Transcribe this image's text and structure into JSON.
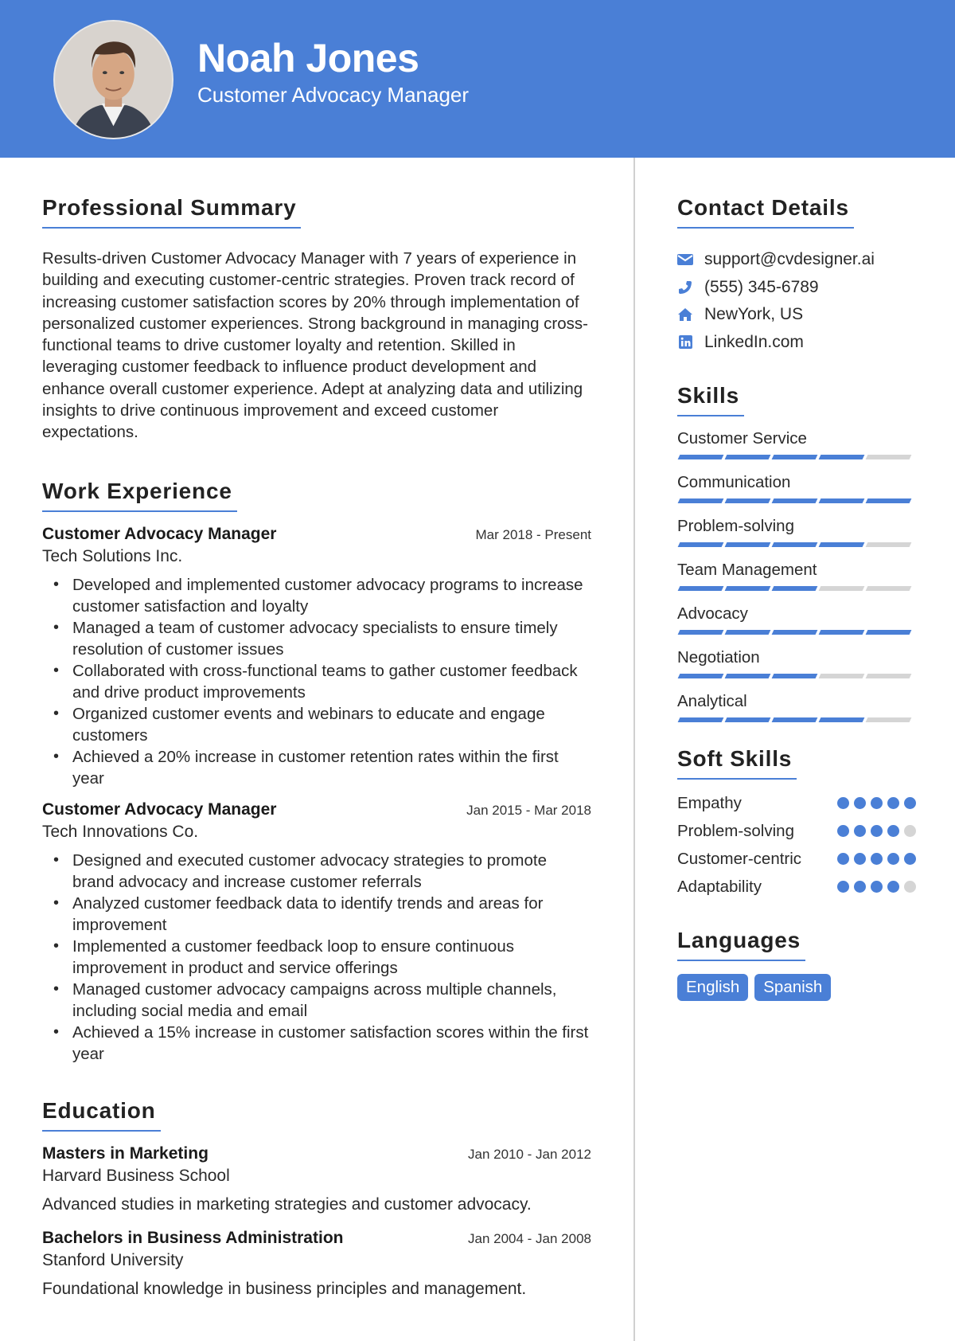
{
  "header": {
    "name": "Noah Jones",
    "title": "Customer Advocacy Manager",
    "accent": "#4a7fd6"
  },
  "summary": {
    "heading": "Professional Summary",
    "text": "Results-driven Customer Advocacy Manager with 7 years of experience in building and executing customer-centric strategies. Proven track record of increasing customer satisfaction scores by 20% through implementation of personalized customer experiences. Strong background in managing cross-functional teams to drive customer loyalty and retention. Skilled in leveraging customer feedback to influence product development and enhance overall customer experience. Adept at analyzing data and utilizing insights to drive continuous improvement and exceed customer expectations."
  },
  "experience": {
    "heading": "Work Experience",
    "jobs": [
      {
        "role": "Customer Advocacy Manager",
        "dates": "Mar 2018 - Present",
        "org": "Tech Solutions Inc.",
        "bullets": [
          "Developed and implemented customer advocacy programs to increase customer satisfaction and loyalty",
          "Managed a team of customer advocacy specialists to ensure timely resolution of customer issues",
          "Collaborated with cross-functional teams to gather customer feedback and drive product improvements",
          "Organized customer events and webinars to educate and engage customers",
          "Achieved a 20% increase in customer retention rates within the first year"
        ]
      },
      {
        "role": "Customer Advocacy Manager",
        "dates": "Jan 2015 - Mar 2018",
        "org": "Tech Innovations Co.",
        "bullets": [
          "Designed and executed customer advocacy strategies to promote brand advocacy and increase customer referrals",
          "Analyzed customer feedback data to identify trends and areas for improvement",
          "Implemented a customer feedback loop to ensure continuous improvement in product and service offerings",
          "Managed customer advocacy campaigns across multiple channels, including social media and email",
          "Achieved a 15% increase in customer satisfaction scores within the first year"
        ]
      }
    ]
  },
  "education": {
    "heading": "Education",
    "items": [
      {
        "degree": "Masters in Marketing",
        "dates": "Jan 2010 - Jan 2012",
        "school": "Harvard Business School",
        "desc": "Advanced studies in marketing strategies and customer advocacy."
      },
      {
        "degree": "Bachelors in Business Administration",
        "dates": "Jan 2004 - Jan 2008",
        "school": "Stanford University",
        "desc": "Foundational knowledge in business principles and management."
      }
    ]
  },
  "contact": {
    "heading": "Contact Details",
    "items": [
      {
        "icon": "envelope-icon",
        "text": "support@cvdesigner.ai"
      },
      {
        "icon": "phone-icon",
        "text": "(555) 345-6789"
      },
      {
        "icon": "home-icon",
        "text": "NewYork, US"
      },
      {
        "icon": "linkedin-icon",
        "text": "LinkedIn.com"
      }
    ]
  },
  "skills": {
    "heading": "Skills",
    "max": 5,
    "items": [
      {
        "name": "Customer Service",
        "level": 4
      },
      {
        "name": "Communication",
        "level": 5
      },
      {
        "name": "Problem-solving",
        "level": 4
      },
      {
        "name": "Team Management",
        "level": 3
      },
      {
        "name": "Advocacy",
        "level": 5
      },
      {
        "name": "Negotiation",
        "level": 3
      },
      {
        "name": "Analytical",
        "level": 4
      }
    ]
  },
  "soft_skills": {
    "heading": "Soft Skills",
    "max": 5,
    "items": [
      {
        "name": "Empathy",
        "level": 5
      },
      {
        "name": "Problem-solving",
        "level": 4
      },
      {
        "name": "Customer-centric",
        "level": 5
      },
      {
        "name": "Adaptability",
        "level": 4
      }
    ]
  },
  "languages": {
    "heading": "Languages",
    "items": [
      "English",
      "Spanish"
    ]
  }
}
